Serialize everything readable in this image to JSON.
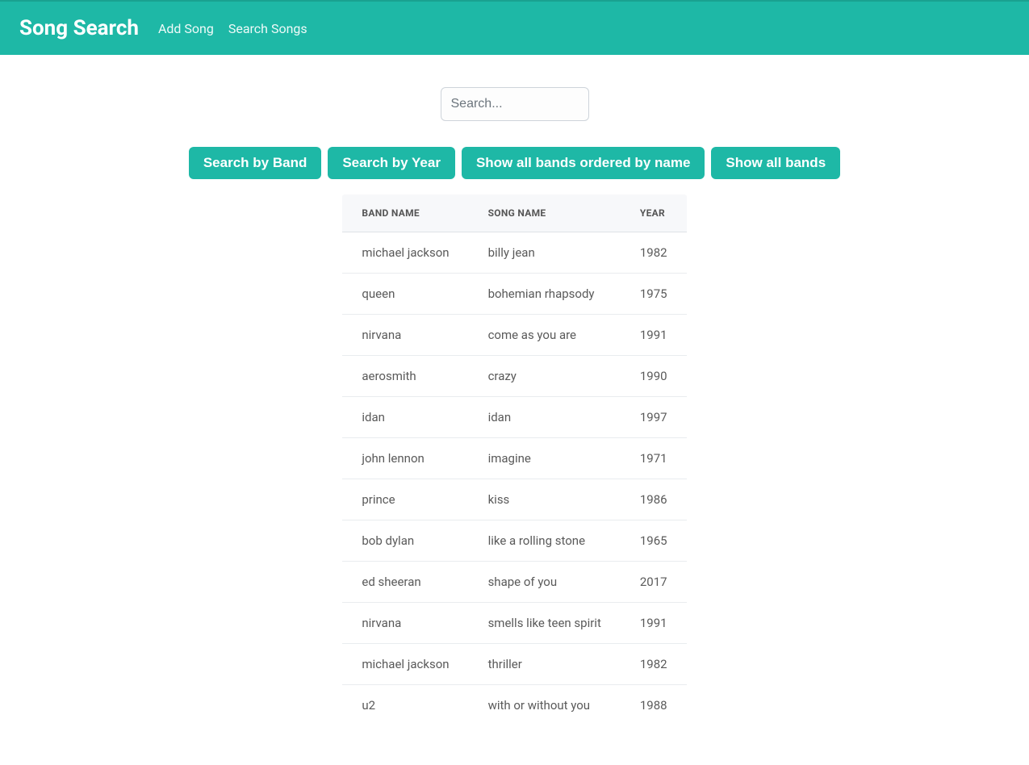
{
  "navbar": {
    "brand": "Song Search",
    "links": [
      "Add Song",
      "Search Songs"
    ]
  },
  "search": {
    "placeholder": "Search..."
  },
  "buttons": [
    "Search by Band",
    "Search by Year",
    "Show all bands ordered by name",
    "Show all bands"
  ],
  "table": {
    "headers": [
      "BAND NAME",
      "SONG NAME",
      "YEAR"
    ],
    "rows": [
      {
        "band": "michael jackson",
        "song": "billy jean",
        "year": "1982"
      },
      {
        "band": "queen",
        "song": "bohemian rhapsody",
        "year": "1975"
      },
      {
        "band": "nirvana",
        "song": "come as you are",
        "year": "1991"
      },
      {
        "band": "aerosmith",
        "song": "crazy",
        "year": "1990"
      },
      {
        "band": "idan",
        "song": "idan",
        "year": "1997"
      },
      {
        "band": "john lennon",
        "song": "imagine",
        "year": "1971"
      },
      {
        "band": "prince",
        "song": "kiss",
        "year": "1986"
      },
      {
        "band": "bob dylan",
        "song": "like a rolling stone",
        "year": "1965"
      },
      {
        "band": "ed sheeran",
        "song": "shape of you",
        "year": "2017"
      },
      {
        "band": "nirvana",
        "song": "smells like teen spirit",
        "year": "1991"
      },
      {
        "band": "michael jackson",
        "song": "thriller",
        "year": "1982"
      },
      {
        "band": "u2",
        "song": "with or without you",
        "year": "1988"
      }
    ]
  }
}
